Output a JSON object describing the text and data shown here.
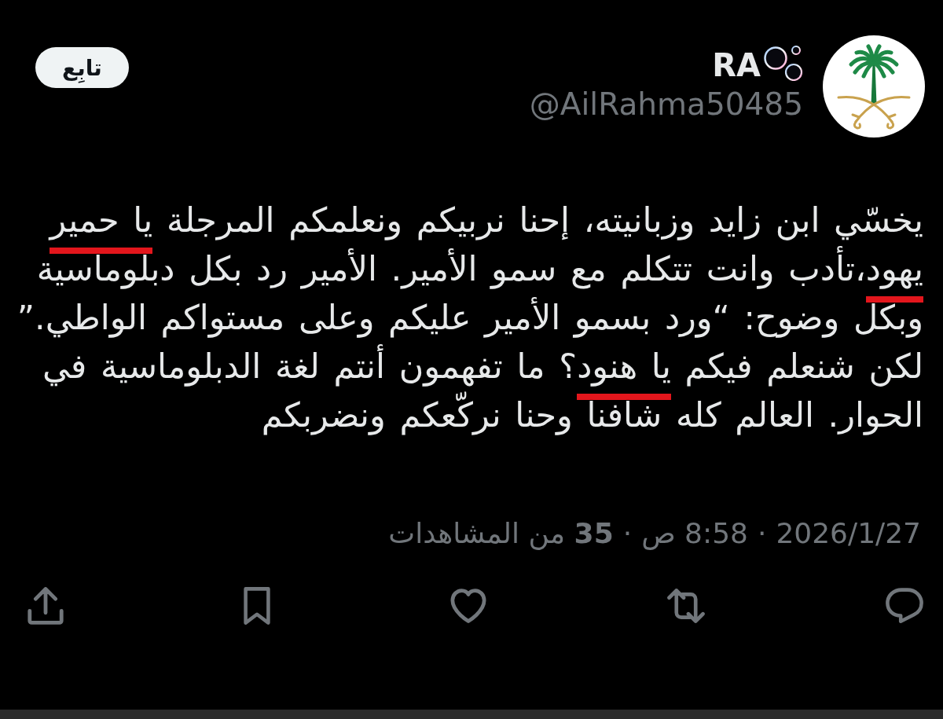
{
  "author": {
    "name": "RA",
    "handle": "@AilRahma50485"
  },
  "follow_button": {
    "label": "تابِع"
  },
  "tweet": {
    "text": [
      {
        "text": "يخسّي ابن زايد وزبانيته، إحنا نربيكم ونعلمكم المرجلة ",
        "underlined": false
      },
      {
        "text": "يا حمير ",
        "underlined": true
      },
      {
        "text": "يهود",
        "underlined": true
      },
      {
        "text": "،تأدب وانت تتكلم مع سمو الأمير. الأمير رد بكل دبلوماسية وبكل وضوح: “ورد بسمو الأمير عليكم وعلى مستواكم الواطي.” لكن شنعلم فيكم ",
        "underlined": false
      },
      {
        "text": "يا هنود",
        "underlined": true
      },
      {
        "text": "؟ ما تفهمون أنتم لغة الدبلوماسية في الحوار. العالم كله شافنا وحنا نركّعكم ونضربكم",
        "underlined": false
      }
    ]
  },
  "meta": {
    "date": "2026/1/27",
    "separators": [
      "·",
      "·"
    ],
    "time": "8:58 ص",
    "views": "**35** من المشاهدات"
  }
}
